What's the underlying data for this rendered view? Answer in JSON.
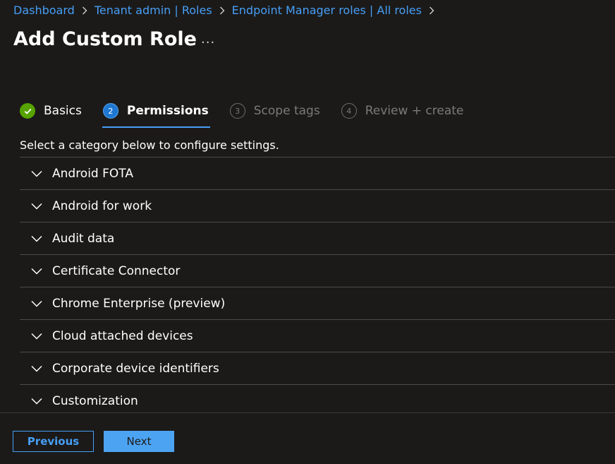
{
  "breadcrumb": {
    "items": [
      "Dashboard",
      "Tenant admin | Roles",
      "Endpoint Manager roles | All roles"
    ]
  },
  "page": {
    "title": "Add Custom Role",
    "more_label": "..."
  },
  "wizard": {
    "steps": [
      {
        "number": "",
        "label": "Basics",
        "state": "completed"
      },
      {
        "number": "2",
        "label": "Permissions",
        "state": "active"
      },
      {
        "number": "3",
        "label": "Scope tags",
        "state": "pending"
      },
      {
        "number": "4",
        "label": "Review + create",
        "state": "pending"
      }
    ]
  },
  "instruction": "Select a category below to configure settings.",
  "categories": [
    "Android FOTA",
    "Android for work",
    "Audit data",
    "Certificate Connector",
    "Chrome Enterprise (preview)",
    "Cloud attached devices",
    "Corporate device identifiers",
    "Customization"
  ],
  "footer": {
    "previous_label": "Previous",
    "next_label": "Next"
  },
  "colors": {
    "background": "#1b1a19",
    "link": "#479ef5",
    "success": "#57a300",
    "active_step": "#1e78d2",
    "primary_button": "#4ca3f1"
  }
}
